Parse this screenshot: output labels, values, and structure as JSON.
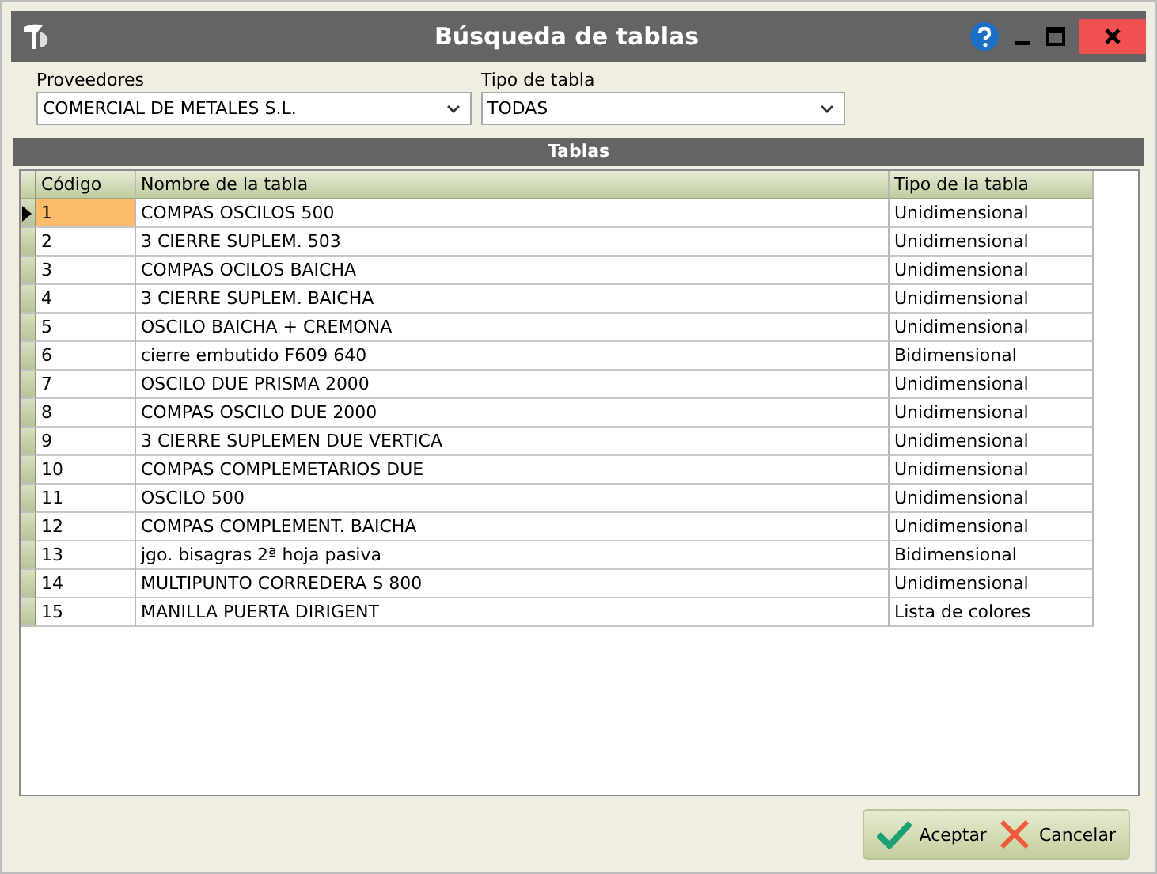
{
  "window": {
    "title": "Búsqueda de tablas"
  },
  "filters": [
    {
      "label": "Proveedores",
      "value": "COMERCIAL DE METALES S.L."
    },
    {
      "label": "Tipo de tabla",
      "value": "TODAS"
    }
  ],
  "table": {
    "title": "Tablas",
    "columns": [
      "Código",
      "Nombre de la tabla",
      "Tipo de la tabla"
    ],
    "rows": [
      {
        "cells": [
          "1",
          "COMPAS OSCILOS 500",
          "Unidimensional"
        ],
        "selected": true
      },
      {
        "cells": [
          "2",
          "3 CIERRE SUPLEM. 503",
          "Unidimensional"
        ],
        "selected": false
      },
      {
        "cells": [
          "3",
          "COMPAS OCILOS BAICHA",
          "Unidimensional"
        ],
        "selected": false
      },
      {
        "cells": [
          "4",
          "3 CIERRE SUPLEM. BAICHA",
          "Unidimensional"
        ],
        "selected": false
      },
      {
        "cells": [
          "5",
          "OSCILO BAICHA + CREMONA",
          "Unidimensional"
        ],
        "selected": false
      },
      {
        "cells": [
          "6",
          "cierre embutido F609 640",
          "Bidimensional"
        ],
        "selected": false
      },
      {
        "cells": [
          "7",
          "OSCILO DUE PRISMA 2000",
          "Unidimensional"
        ],
        "selected": false
      },
      {
        "cells": [
          "8",
          "COMPAS OSCILO DUE 2000",
          "Unidimensional"
        ],
        "selected": false
      },
      {
        "cells": [
          "9",
          "3 CIERRE SUPLEMEN DUE VERTICA",
          "Unidimensional"
        ],
        "selected": false
      },
      {
        "cells": [
          "10",
          "COMPAS COMPLEMETARIOS DUE",
          "Unidimensional"
        ],
        "selected": false
      },
      {
        "cells": [
          "11",
          "OSCILO 500",
          "Unidimensional"
        ],
        "selected": false
      },
      {
        "cells": [
          "12",
          "COMPAS COMPLEMENT. BAICHA",
          "Unidimensional"
        ],
        "selected": false
      },
      {
        "cells": [
          "13",
          "jgo. bisagras 2ª hoja pasiva",
          "Bidimensional"
        ],
        "selected": false
      },
      {
        "cells": [
          "14",
          "MULTIPUNTO CORREDERA S 800",
          "Unidimensional"
        ],
        "selected": false
      },
      {
        "cells": [
          "15",
          "MANILLA PUERTA DIRIGENT",
          "Lista de colores"
        ],
        "selected": false
      }
    ]
  },
  "buttons": [
    {
      "label": "Aceptar",
      "kind": "ok"
    },
    {
      "label": "Cancelar",
      "kind": "cancel"
    }
  ]
}
